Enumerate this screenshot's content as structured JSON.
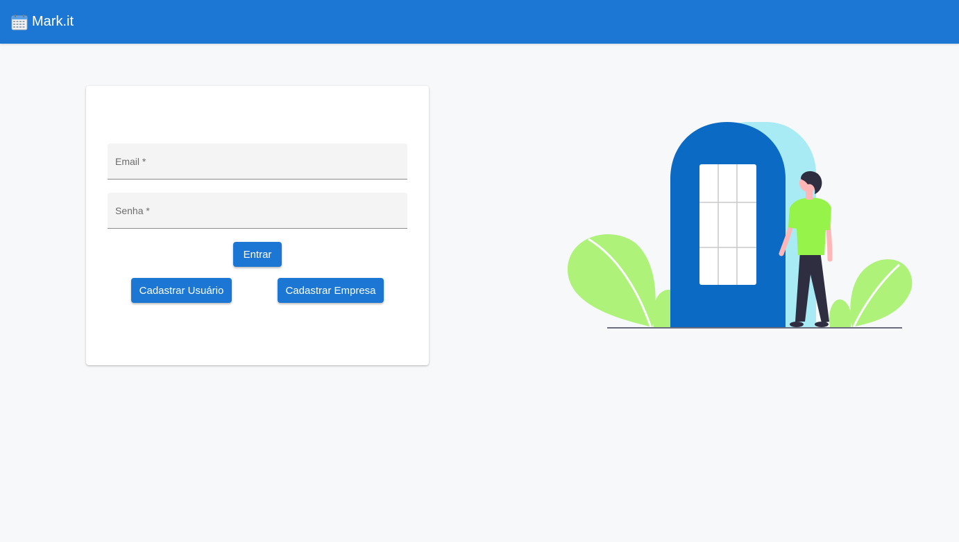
{
  "header": {
    "title": "Mark.it",
    "icon": "calendar-icon",
    "background": "#1c77d4"
  },
  "login": {
    "email_label": "Email *",
    "password_label": "Senha *",
    "submit_label": "Entrar",
    "register_user_label": "Cadastrar Usuário",
    "register_company_label": "Cadastrar Empresa"
  },
  "colors": {
    "primary": "#1c77d4",
    "door": "#0b6ac3",
    "door_shadow": "#a8ebf5",
    "leaf": "#aef27a",
    "shirt": "#95f34a",
    "pants": "#2f2e41"
  }
}
